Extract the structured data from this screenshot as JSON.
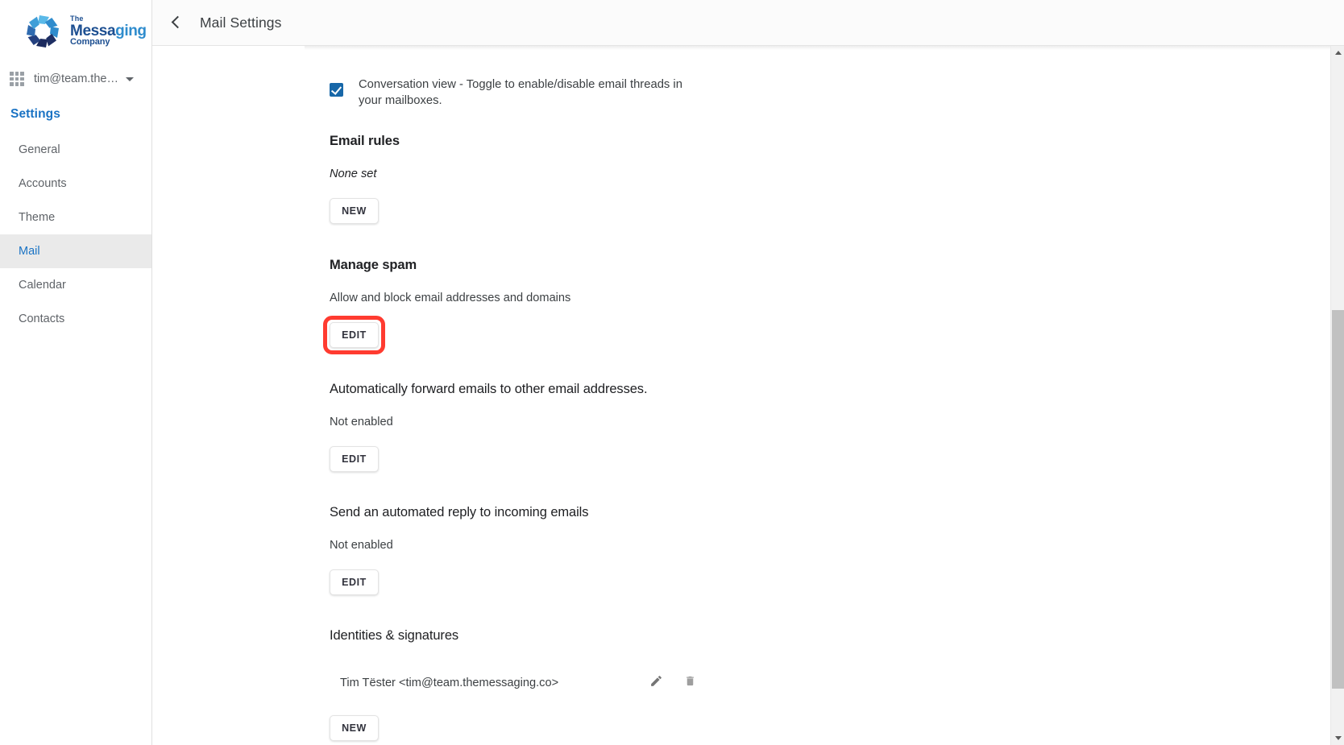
{
  "brand": {
    "logo_the": "The",
    "logo_messaging": "Messaging",
    "logo_company": "Company",
    "logo_icon": "messaging-company-logo",
    "primary_color": "#1a73c4",
    "logo_blue_dark": "#1b2a5e",
    "logo_blue_mid": "#2a6fb5",
    "logo_blue_light": "#4bb3e6"
  },
  "sidebar": {
    "apps_icon": "apps-grid-icon",
    "account_email": "tim@team.the…",
    "account_caret_icon": "chevron-down-icon",
    "settings_title": "Settings",
    "items": [
      {
        "label": "General",
        "active": false
      },
      {
        "label": "Accounts",
        "active": false
      },
      {
        "label": "Theme",
        "active": false
      },
      {
        "label": "Mail",
        "active": true
      },
      {
        "label": "Calendar",
        "active": false
      },
      {
        "label": "Contacts",
        "active": false
      }
    ]
  },
  "topbar": {
    "back_icon": "back-chevron-icon",
    "title": "Mail Settings"
  },
  "main": {
    "conversation_view": {
      "checked": true,
      "label": "Conversation view - Toggle to enable/disable email threads in your mailboxes."
    },
    "email_rules": {
      "heading": "Email rules",
      "status": "None set",
      "button": "NEW"
    },
    "manage_spam": {
      "heading": "Manage spam",
      "description": "Allow and block email addresses and domains",
      "button": "EDIT",
      "highlighted": true,
      "highlight_color": "#ff3b30"
    },
    "auto_forward": {
      "heading": "Automatically forward emails to other email addresses.",
      "status": "Not enabled",
      "button": "EDIT"
    },
    "auto_reply": {
      "heading": "Send an automated reply to incoming emails",
      "status": "Not enabled",
      "button": "EDIT"
    },
    "identities": {
      "heading": "Identities & signatures",
      "rows": [
        {
          "name": "Tim Tëster <tim@team.themessaging.co>",
          "edit_icon": "pencil-icon",
          "delete_icon": "trash-icon"
        }
      ],
      "button": "NEW"
    }
  },
  "scrollbar": {
    "up_icon": "scroll-up-arrow-icon",
    "down_icon": "scroll-down-arrow-icon",
    "thumb": "scrollbar-thumb"
  }
}
